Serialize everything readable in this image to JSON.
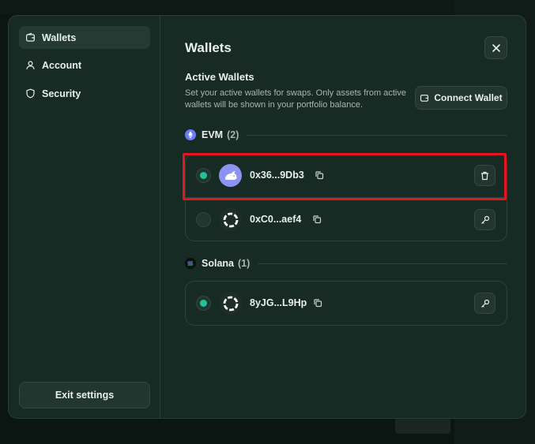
{
  "sidebar": {
    "items": [
      {
        "label": "Wallets",
        "icon": "wallet-icon",
        "active": true
      },
      {
        "label": "Account",
        "icon": "user-icon",
        "active": false
      },
      {
        "label": "Security",
        "icon": "shield-icon",
        "active": false
      }
    ],
    "exit_label": "Exit settings"
  },
  "header": {
    "title": "Wallets",
    "close_icon": "close-icon"
  },
  "active_wallets": {
    "title": "Active Wallets",
    "description": "Set your active wallets for swaps. Only assets from active wallets will be shown in your portfolio balance.",
    "connect_label": "Connect Wallet"
  },
  "groups": {
    "evm": {
      "name": "EVM",
      "count": "(2)",
      "icon": "ethereum-icon",
      "wallets": [
        {
          "address": "0x36...9Db3",
          "active": true,
          "avatar": "rabbit-avatar",
          "action_icon": "trash-icon"
        },
        {
          "address": "0xC0...aef4",
          "active": false,
          "avatar": "ring-avatar",
          "action_icon": "key-icon"
        }
      ]
    },
    "solana": {
      "name": "Solana",
      "count": "(1)",
      "icon": "solana-icon",
      "wallets": [
        {
          "address": "8yJG...L9Hp",
          "active": true,
          "avatar": "ring-avatar",
          "action_icon": "key-icon"
        }
      ]
    }
  },
  "colors": {
    "accent": "#1ec39a",
    "highlight": "#e4151c",
    "panel": "#172a24"
  }
}
